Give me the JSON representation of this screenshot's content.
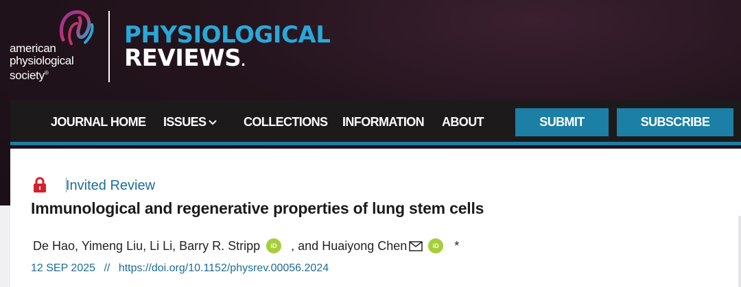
{
  "publisher": {
    "logo_lines": [
      "american",
      "physiological",
      "society"
    ],
    "logo_registered": "®"
  },
  "journal": {
    "title_line1": "PHYSIOLOGICAL",
    "title_line2": "REVIEWS",
    "title_dot": "."
  },
  "nav": {
    "items": [
      "JOURNAL HOME",
      "ISSUES",
      "COLLECTIONS",
      "INFORMATION",
      "ABOUT"
    ],
    "submit_label": "SUBMIT",
    "subscribe_label": "SUBSCRIBE"
  },
  "article": {
    "type": "Invited Review",
    "title": "Immunological and regenerative properties of lung stem cells",
    "authors_part1": "De Hao, Yimeng Liu, Li Li, Barry R. Stripp",
    "authors_sep": ", and Huaiyong Chen",
    "corresponding_marker": "*",
    "orcid_label": "iD",
    "date": "12 SEP 2025",
    "separator": "//",
    "doi": "https://doi.org/10.1152/physrev.00056.2024"
  },
  "icons": {
    "lock": "lock-icon",
    "orcid": "orcid-icon",
    "mail": "mail-icon",
    "chevron": "chevron-down-icon"
  },
  "colors": {
    "header_background": "#1b1017",
    "journal_accent": "#29a8d8",
    "nav_background": "#1d1a1c",
    "nav_button": "#1b7fa6",
    "link_blue": "#1b6c98",
    "orcid_green": "#a6ce39",
    "lock_red": "#d6202a"
  }
}
